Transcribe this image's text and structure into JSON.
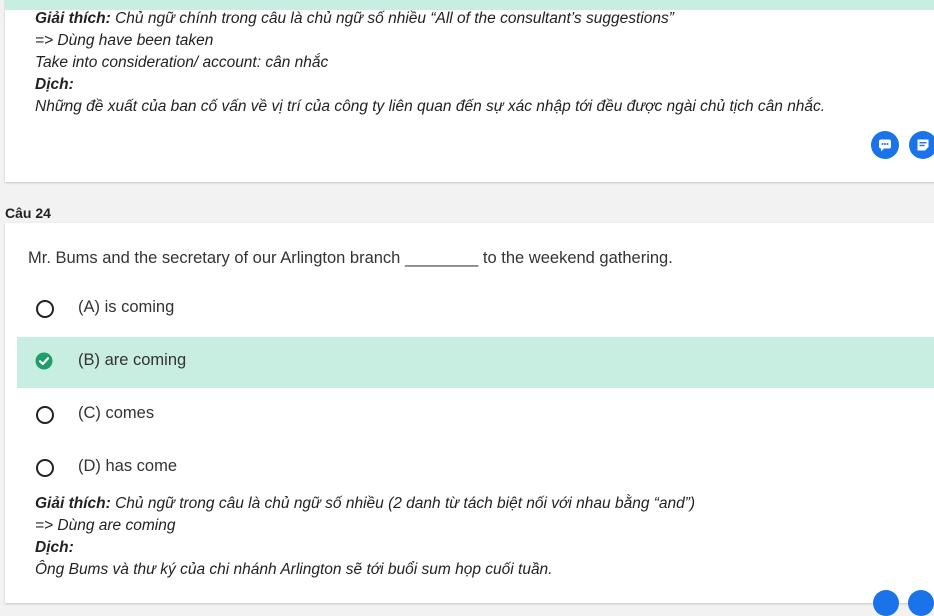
{
  "prev_explanation": {
    "label": "Giải thích:",
    "text": " Chủ ngữ chính trong câu là chủ ngữ số nhiều “All of the consultant’s suggestions”",
    "line2": "=> Dùng have been taken",
    "line3": "Take into consideration/ account: cân nhắc",
    "translation_label": "Dịch:",
    "translation": "Những đề xuất của ban cố vấn về vị trí của công ty liên quan đến sự xác nhập tới đều được ngài chủ tịch cân nhắc."
  },
  "question": {
    "number_label": "Câu 24",
    "text": "Mr. Bums and the secretary of our Arlington branch ________ to the weekend gathering.",
    "options": [
      {
        "label": "(A) is coming",
        "selected": false
      },
      {
        "label": "(B) are coming",
        "selected": true
      },
      {
        "label": "(C) comes",
        "selected": false
      },
      {
        "label": "(D) has come",
        "selected": false
      }
    ],
    "explanation": {
      "label": "Giải thích:",
      "text": " Chủ ngữ trong câu là chủ ngữ số nhiều (2 danh từ tách biệt nối với nhau bằng “and”)",
      "line2": "=> Dùng are coming",
      "translation_label": "Dịch:",
      "translation": "Ông Bums và thư ký của chi nhánh Arlington sẽ tới buổi sum họp cuối tuần."
    }
  },
  "icons": {
    "comment": "comment-icon",
    "note": "note-icon",
    "check": "check-circle-icon"
  },
  "colors": {
    "selected_bg": "#c8ede1",
    "correct_green": "#1e9e6a",
    "fab_blue": "#1a73e8"
  }
}
